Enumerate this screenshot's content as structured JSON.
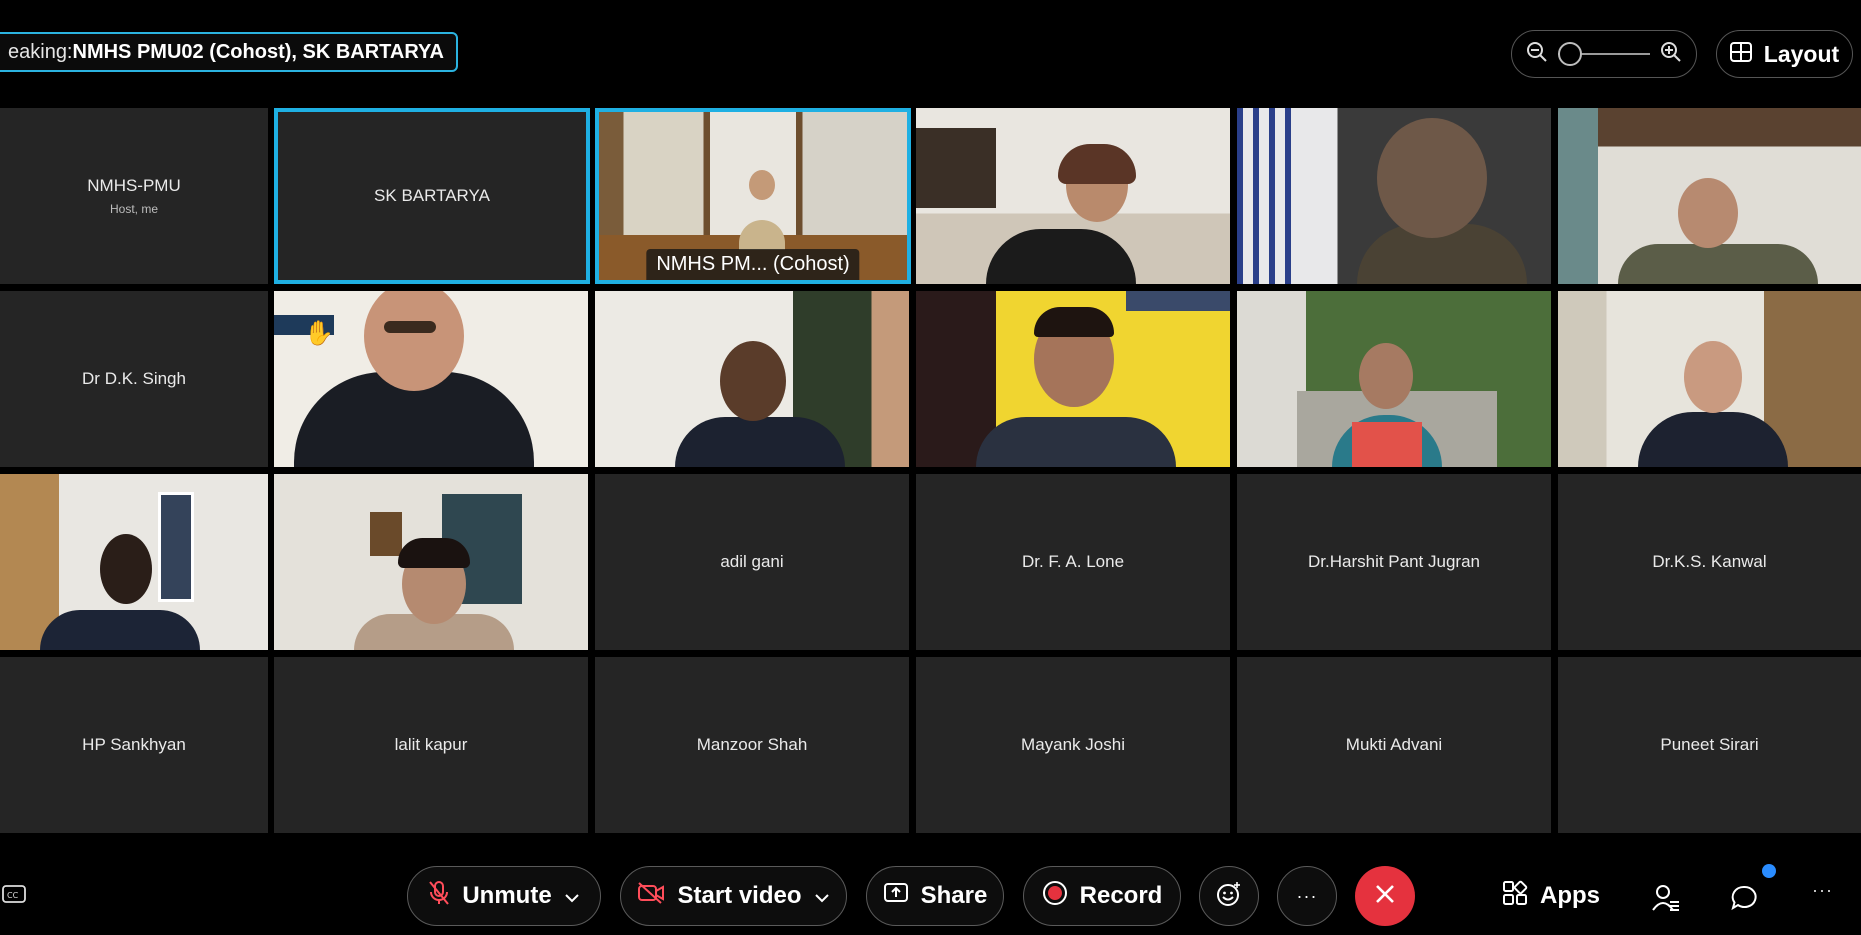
{
  "speaking": {
    "prefix": "eaking: ",
    "names": "NMHS PMU02 (Cohost), SK BARTARYA"
  },
  "zoom": {
    "level": 0.0,
    "minus_icon": "zoom-out-icon",
    "plus_icon": "zoom-in-icon"
  },
  "layout": {
    "label": "Layout",
    "icon": "layout-grid-icon"
  },
  "tiles": [
    {
      "name": "NMHS-PMU",
      "sub": "Host, me"
    },
    {
      "name": "SK BARTARYA"
    },
    {
      "caption": "NMHS PM... (Cohost)"
    },
    {},
    {},
    {},
    {
      "name": "Dr D.K. Singh"
    },
    {},
    {},
    {},
    {},
    {},
    {},
    {},
    {
      "name": "adil gani"
    },
    {
      "name": "Dr. F. A. Lone"
    },
    {
      "name": "Dr.Harshit Pant Jugran"
    },
    {
      "name": "Dr.K.S. Kanwal"
    },
    {
      "name": "HP Sankhyan"
    },
    {
      "name": "lalit kapur"
    },
    {
      "name": "Manzoor Shah"
    },
    {
      "name": "Mayank Joshi"
    },
    {
      "name": "Mukti Advani"
    },
    {
      "name": "Puneet Sirari"
    }
  ],
  "bottom": {
    "unmute": "Unmute",
    "start_video": "Start video",
    "share": "Share",
    "record": "Record",
    "apps": "Apps",
    "more": "···",
    "more_right": "···"
  },
  "colors": {
    "active_border": "#1fb0e3",
    "end_call": "#e5323e",
    "notification": "#2a8cff"
  }
}
